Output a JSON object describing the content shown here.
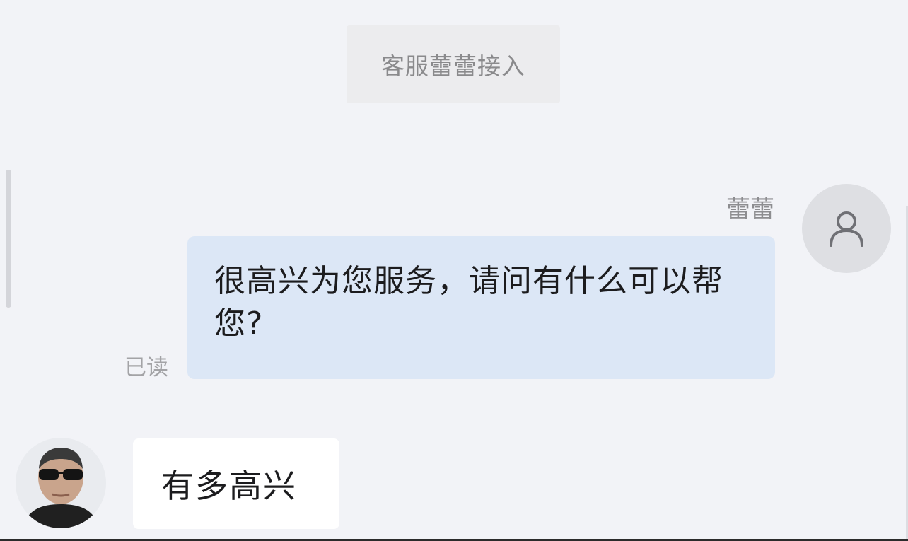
{
  "chat": {
    "system_notice": "客服蕾蕾接入",
    "messages": [
      {
        "sender": "agent",
        "sender_name": "蕾蕾",
        "avatar_icon": "person-outline-icon",
        "text": "很高兴为您服务，请问有什么可以帮您?",
        "status": "已读"
      },
      {
        "sender": "user",
        "avatar_icon": "user-photo-avatar",
        "text": "有多高兴"
      }
    ]
  },
  "colors": {
    "background": "#f2f3f7",
    "agent_bubble": "#dce7f6",
    "user_bubble": "#ffffff",
    "notice_bg": "#ececee"
  }
}
